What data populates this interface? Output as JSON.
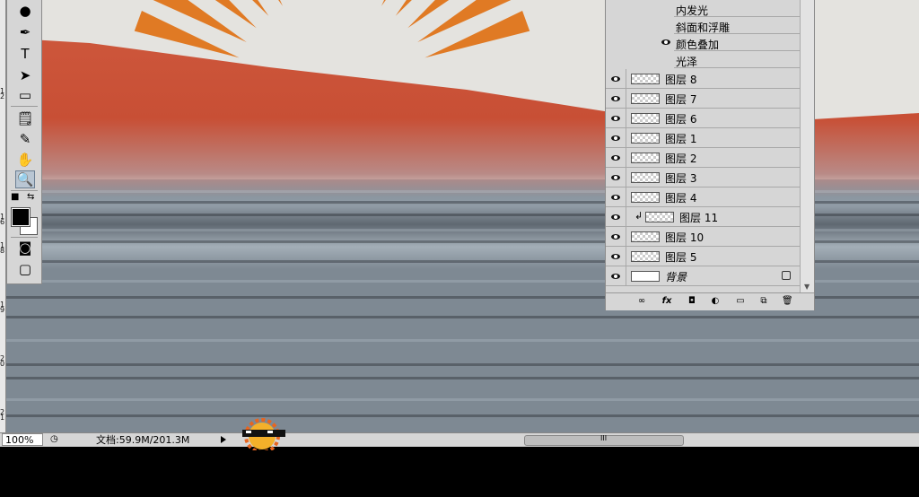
{
  "colors": {
    "accent_red": "#cf5a3e",
    "sun_orange": "#e07a24",
    "panel_gray": "#d6d6d6"
  },
  "ruler": {
    "numbers": [
      "1",
      "2",
      "1",
      "6",
      "1",
      "8",
      "1",
      "9",
      "2",
      "0",
      "2",
      "1"
    ]
  },
  "toolbox": {
    "tools": [
      {
        "name": "smudge-tool-icon",
        "glyph": "●"
      },
      {
        "name": "pen-tool-icon",
        "glyph": "✒"
      },
      {
        "name": "type-tool-icon",
        "glyph": "T"
      },
      {
        "name": "path-selection-tool-icon",
        "glyph": "➤"
      },
      {
        "name": "shape-tool-icon",
        "glyph": "▭"
      },
      {
        "name": "notes-tool-icon",
        "glyph": "🗒"
      },
      {
        "name": "eyedropper-tool-icon",
        "glyph": "✎"
      },
      {
        "name": "hand-tool-icon",
        "glyph": "✋"
      },
      {
        "name": "zoom-tool-icon",
        "glyph": "🔍"
      }
    ],
    "selected_tool": "zoom-tool-icon",
    "foreground_color": "#000000",
    "background_color": "#ffffff"
  },
  "layers_panel": {
    "effects": [
      {
        "label": "内发光",
        "visible": false
      },
      {
        "label": "斜面和浮雕",
        "visible": false
      },
      {
        "label": "颜色叠加",
        "visible": true
      },
      {
        "label": "光泽",
        "visible": false
      }
    ],
    "layers": [
      {
        "name": "图层 8",
        "visible": true,
        "clipped": false
      },
      {
        "name": "图层 7",
        "visible": true,
        "clipped": false
      },
      {
        "name": "图层 6",
        "visible": true,
        "clipped": false
      },
      {
        "name": "图层 1",
        "visible": true,
        "clipped": false
      },
      {
        "name": "图层 2",
        "visible": true,
        "clipped": false
      },
      {
        "name": "图层 3",
        "visible": true,
        "clipped": false
      },
      {
        "name": "图层 4",
        "visible": true,
        "clipped": false
      },
      {
        "name": "图层 11",
        "visible": true,
        "clipped": true
      },
      {
        "name": "图层 10",
        "visible": true,
        "clipped": false
      },
      {
        "name": "图层 5",
        "visible": true,
        "clipped": false
      },
      {
        "name": "背景",
        "visible": true,
        "clipped": false,
        "locked": true
      }
    ],
    "footer_icons": [
      "link-icon",
      "fx-icon",
      "mask-icon",
      "adjustment-icon",
      "folder-icon",
      "new-layer-icon",
      "trash-icon"
    ],
    "footer_fx_label": "fx"
  },
  "status_bar": {
    "zoom": "100%",
    "doc_info": "文档:59.9M/201.3M",
    "scroll_grip": "III"
  }
}
